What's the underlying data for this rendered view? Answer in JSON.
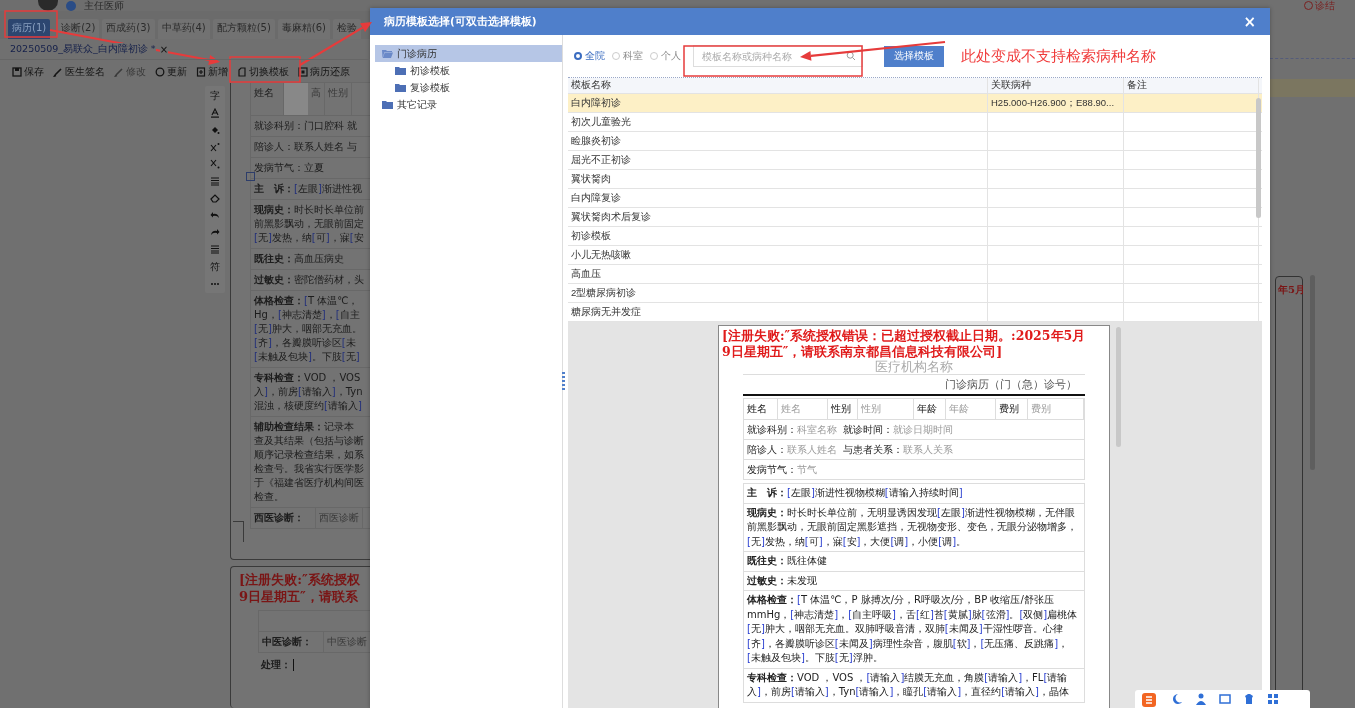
{
  "app": {
    "user_role": "主任医师",
    "top_right_action": "诊结",
    "tabs": [
      {
        "label": "病历(1)",
        "selected": true
      },
      {
        "label": "诊断(2)",
        "selected": false
      },
      {
        "label": "西成药(3)",
        "selected": false
      },
      {
        "label": "中草药(4)",
        "selected": false
      },
      {
        "label": "配方颗粒(5)",
        "selected": false
      },
      {
        "label": "毒麻精(6)",
        "selected": false
      },
      {
        "label": "检验",
        "selected": false
      }
    ],
    "document_tab": {
      "label": "20250509_易联众_白内障初诊 *",
      "close": "×"
    },
    "toolbar": [
      {
        "label": "保存",
        "kind": "save",
        "disabled": false
      },
      {
        "label": "医生签名",
        "kind": "sign",
        "disabled": false
      },
      {
        "label": "修改",
        "kind": "edit",
        "disabled": true
      },
      {
        "label": "更新",
        "kind": "refresh",
        "disabled": false
      },
      {
        "label": "新增",
        "kind": "add",
        "disabled": false
      },
      {
        "label": "切换模板",
        "kind": "switch",
        "disabled": false
      },
      {
        "label": "病历还原",
        "kind": "restore",
        "disabled": false
      }
    ],
    "format_tools": [
      {
        "kind": "glyph",
        "label": "字"
      },
      {
        "kind": "font-color"
      },
      {
        "kind": "fill"
      },
      {
        "kind": "superscript"
      },
      {
        "kind": "subscript"
      },
      {
        "kind": "align"
      },
      {
        "kind": "eraser"
      },
      {
        "kind": "undo"
      },
      {
        "kind": "redo"
      },
      {
        "kind": "list"
      },
      {
        "kind": "glyph",
        "label": "符"
      },
      {
        "kind": "more"
      }
    ],
    "record_page": {
      "rows": [
        {
          "kind": "cells",
          "cells": [
            {
              "text": "姓名",
              "redacted": false
            },
            {
              "text": "高",
              "redacted": true
            },
            {
              "text": "性别",
              "redacted": false
            }
          ]
        },
        {
          "kind": "line",
          "text": "就诊科别：门口腔科  就"
        },
        {
          "kind": "line",
          "text": "陪诊人：联系人姓名  与"
        },
        {
          "kind": "line",
          "text": "发病节气：立夏"
        },
        {
          "kind": "section",
          "label": "主　诉：",
          "lines": [
            "[左眼]渐进性视"
          ]
        },
        {
          "kind": "section",
          "label": "现病史：",
          "lines": [
            "时长时长单位前",
            "前黑影飘动，无眼前固定",
            "[无]发热，纳[可]，寐[安"
          ]
        },
        {
          "kind": "section",
          "label": "既往史：",
          "lines": [
            "高血压病史"
          ]
        },
        {
          "kind": "section",
          "label": "过敏史：",
          "lines": [
            "密陀僧药材，头"
          ]
        },
        {
          "kind": "section",
          "label": "体格检查：",
          "lines": [
            "[T 体温℃，",
            "Hg，[神志清楚]，[自主",
            "[无]肿大，咽部无充血。",
            "[齐]，各瓣膜听诊区[未",
            "[未触及包块]。下肢[无]"
          ]
        },
        {
          "kind": "section",
          "label": "专科检查：",
          "lines": [
            "VOD ，VOS",
            "入]，前房[请输入]，Tyn",
            "混浊，核硬度约[请输入]"
          ]
        },
        {
          "kind": "section",
          "label": "辅助检查结果：",
          "lines": [
            "记录本",
            "查及其结果（包括与诊断",
            "顺序记录检查结果，如系",
            "检查号。我省实行医学影",
            "于《福建省医疗机构间医",
            "检查。"
          ]
        },
        {
          "kind": "cells",
          "cells": [
            {
              "text": "西医诊断：",
              "redacted": false
            },
            {
              "text": "西医诊断",
              "redacted": false
            }
          ]
        }
      ]
    },
    "second_page": {
      "license_error": [
        "[注册失败:″系统授权",
        "9日星期五″，请联系"
      ],
      "rows": [
        {
          "kind": "blank"
        },
        {
          "kind": "cells",
          "cells": [
            {
              "text": "中医诊断：",
              "redacted": false
            },
            {
              "text": "中医诊断",
              "redacted": false
            }
          ]
        },
        {
          "kind": "section",
          "label": "处理："
        }
      ]
    },
    "right_page_fragment": "年5月"
  },
  "dialog": {
    "title": "病历模板选择(可双击选择模板)",
    "close": "×",
    "tree": [
      {
        "label": "门诊病历",
        "selected": true,
        "expanded": true,
        "children": [
          {
            "label": "初诊模板",
            "selected": false
          },
          {
            "label": "复诊模板",
            "selected": false
          }
        ]
      },
      {
        "label": "其它记录",
        "selected": false,
        "expanded": false
      }
    ],
    "scopes": [
      {
        "label": "全院",
        "selected": true
      },
      {
        "label": "科室",
        "selected": false
      },
      {
        "label": "个人",
        "selected": false
      }
    ],
    "search": {
      "placeholder": "模板名称或病种名称"
    },
    "select_button": "选择模板",
    "table": {
      "columns": [
        "模板名称",
        "关联病种",
        "备注"
      ],
      "rows": [
        {
          "name": "白内障初诊",
          "disease": "H25.000-H26.900；E88.90...",
          "selected": true
        },
        {
          "name": "初次儿童验光",
          "selected": false
        },
        {
          "name": "睑腺炎初诊",
          "selected": false
        },
        {
          "name": "屈光不正初诊",
          "selected": false
        },
        {
          "name": "翼状胬肉",
          "selected": false
        },
        {
          "name": "白内障复诊",
          "selected": false
        },
        {
          "name": "翼状胬肉术后复诊",
          "selected": false
        },
        {
          "name": "初诊模板",
          "selected": false
        },
        {
          "name": "小儿无热咳嗽",
          "selected": false
        },
        {
          "name": "高血压",
          "selected": false
        },
        {
          "name": "2型糖尿病初诊",
          "selected": false
        },
        {
          "name": "糖尿病无并发症",
          "selected": false
        }
      ]
    },
    "preview": {
      "license_error": [
        "[注册失败:″系统授权错误：已超过授权截止日期。:2025年5月",
        "9日星期五″，请联系南京都昌信息科技有限公司]"
      ],
      "org_name": "医疗机构名称",
      "record_title": "门诊病历（门（急）诊号）",
      "info_cells": [
        {
          "label": "姓名",
          "value": "姓名"
        },
        {
          "label": "性别",
          "value": "性别"
        },
        {
          "label": "年龄",
          "value": "年龄"
        },
        {
          "label": "费别",
          "value": "费别"
        }
      ],
      "info_rows": [
        [
          {
            "label": "就诊科别：",
            "value": "科室名称"
          },
          {
            "label": "就诊时间：",
            "value": "就诊日期时间"
          }
        ],
        [
          {
            "label": "陪诊人：",
            "value": "联系人姓名"
          },
          {
            "label": "与患者关系：",
            "value": "联系人关系"
          }
        ],
        [
          {
            "label": "发病节气：",
            "value": "节气"
          }
        ]
      ],
      "sections": [
        {
          "label": "主　诉：",
          "text": "[左眼]渐进性视物模糊[请输入持续时间]"
        },
        {
          "label": "现病史：",
          "text": "时长时长单位前，无明显诱因发现[左眼]渐进性视物模糊，无伴眼前黑影飘动，无眼前固定黑影遮挡，无视物变形、变色，无眼分泌物增多，[无]发热，纳[可]，寐[安]，大便[调]，小便[调]。"
        },
        {
          "label": "既往史：",
          "text": "既往体健"
        },
        {
          "label": "过敏史：",
          "text": "未发现"
        },
        {
          "label": "体格检查：",
          "text": "[T 体温℃，P 脉搏次/分，R呼吸次/分，BP 收缩压/舒张压mmHg，[神志清楚]，[自主呼吸]，舌[红]苔[黄腻]脉[弦滑]。[双侧]扁桃体[无]肿大，咽部无充血。双肺呼吸音清，双肺[未闻及]干湿性啰音。心律[齐]，各瓣膜听诊区[未闻及]病理性杂音，腹肌[软]，[无压痛、反跳痛]，[未触及包块]。下肢[无]浮肿。"
        },
        {
          "label": "专科检查：",
          "text": "VOD ，VOS ，[请输入]结膜无充血，角膜[请输入]，FL[请输入]，前房[请输入]，Tyn[请输入]，瞳孔[请输入]，直径约[请输入]，晶体"
        }
      ]
    }
  },
  "annotation": {
    "note": "此处变成不支持检索病种名称"
  }
}
